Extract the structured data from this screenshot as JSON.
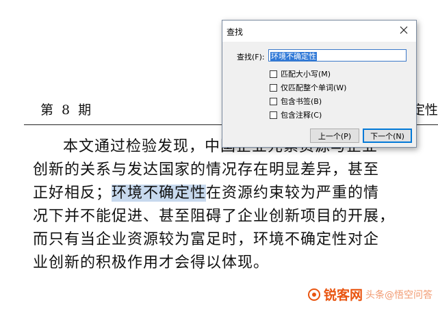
{
  "document": {
    "header_left": "第 8 期",
    "header_right": "定性",
    "lines": [
      {
        "pre": "本文通过检验发现，中国企业元素资源与企业",
        "hl": "",
        "post": ""
      },
      {
        "pre": "创新的关系与发达国家的情况存在明显差异，甚至",
        "hl": "",
        "post": ""
      },
      {
        "pre": "正好相反；",
        "hl": "环境不确定性",
        "post": "在资源约束较为严重的情"
      },
      {
        "pre": "况下并不能促进、甚至阻碍了企业创新项目的开展，",
        "hl": "",
        "post": ""
      },
      {
        "pre": "而只有当企业资源较为富足时，环境不确定性对企",
        "hl": "",
        "post": ""
      },
      {
        "pre": "业创新的积极作用才会得以体现。",
        "hl": "",
        "post": ""
      }
    ]
  },
  "dialog": {
    "title": "查找",
    "find_label": "查找(F):",
    "find_value": "环境不确定性",
    "options": [
      {
        "label": "匹配大小写(M)",
        "checked": false
      },
      {
        "label": "仅匹配整个单词(W)",
        "checked": false
      },
      {
        "label": "包含书签(B)",
        "checked": false
      },
      {
        "label": "包含注释(C)",
        "checked": false
      }
    ],
    "prev_button": "上一个(P)",
    "next_button": "下一个(N)"
  },
  "watermark": {
    "brand": "锐客网",
    "site": "头条@悟空问答"
  },
  "colors": {
    "highlight": "#c7d9ee",
    "selection": "#3079d7",
    "accent_border": "#0078d7",
    "watermark": "#e9540f"
  },
  "icons": [
    "close-icon",
    "checkbox-icon",
    "watermark-logo-icon"
  ]
}
